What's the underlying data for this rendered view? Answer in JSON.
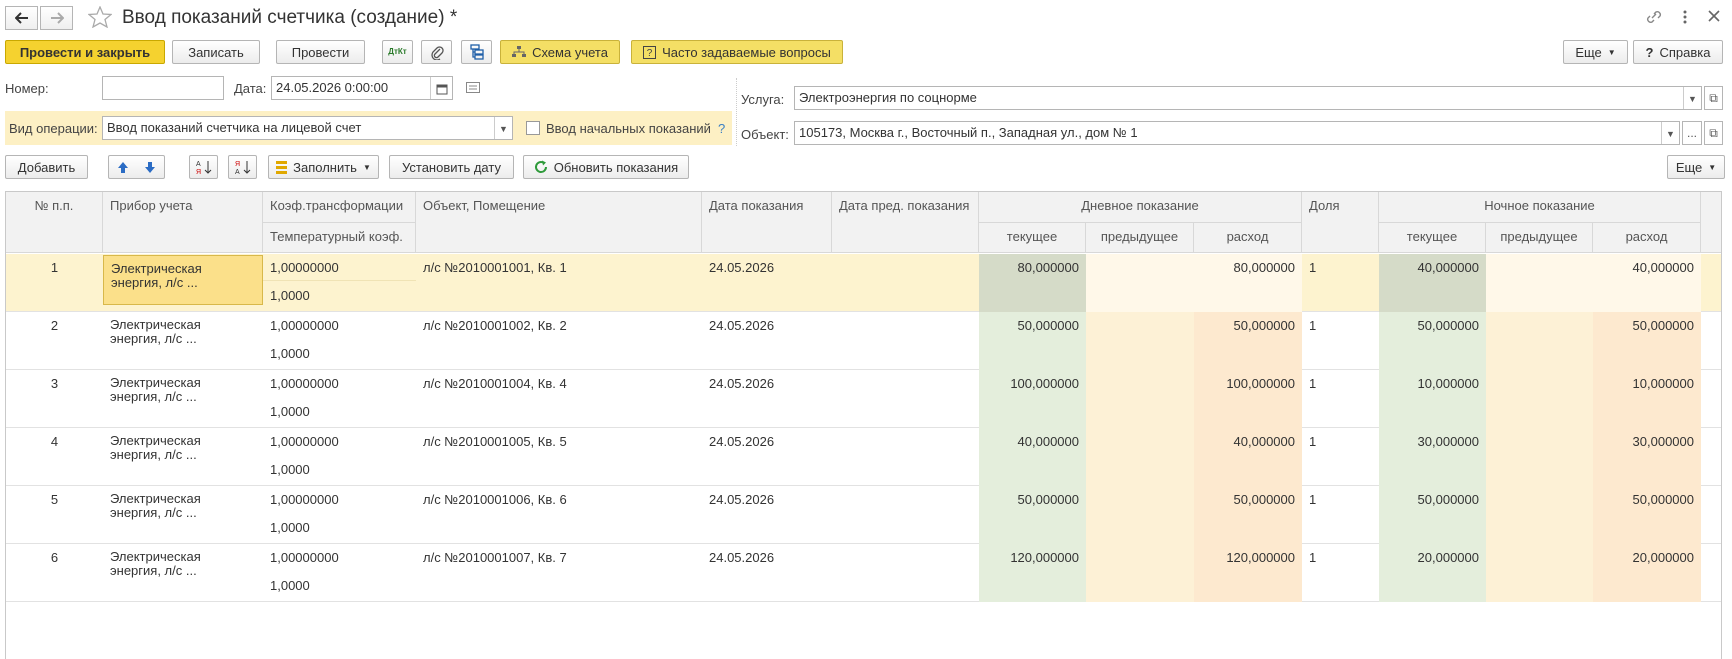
{
  "window": {
    "title": "Ввод показаний счетчика (создание) *"
  },
  "toolbar": {
    "post_and_close": "Провести и закрыть",
    "save": "Записать",
    "post": "Провести",
    "dtkt_label": "ДтКт",
    "scheme": "Схема учета",
    "faq": "Часто задаваемые вопросы",
    "more": "Еще",
    "help": "Справка"
  },
  "header": {
    "number_label": "Номер:",
    "number_value": "",
    "date_label": "Дата:",
    "date_value": "24.05.2026  0:00:00",
    "operation_label": "Вид операции:",
    "operation_value": "Ввод показаний счетчика на лицевой счет",
    "initial_readings_label": "Ввод начальных показаний",
    "initial_readings_help": "?",
    "service_label": "Услуга:",
    "service_value": "Электроэнергия по соцнорме",
    "object_label": "Объект:",
    "object_value": "105173, Москва г., Восточный п., Западная ул., дом № 1"
  },
  "table_toolbar": {
    "add": "Добавить",
    "fill": "Заполнить",
    "set_date": "Установить дату",
    "refresh": "Обновить показания",
    "more": "Еще"
  },
  "table": {
    "headers": {
      "num": "№ п.п.",
      "device": "Прибор учета",
      "koef": "Коэф.трансформации",
      "temp_koef": "Температурный коэф.",
      "object": "Объект, Помещение",
      "date": "Дата показания",
      "prev_date": "Дата пред. показания",
      "day_group": "Дневное показание",
      "day_current": "текущее",
      "day_prev": "предыдущее",
      "day_usage": "расход",
      "share": "Доля",
      "night_group": "Ночное показание",
      "night_current": "текущее",
      "night_prev": "предыдущее",
      "night_usage": "расход"
    },
    "rows": [
      {
        "num": "1",
        "device_l1": "Электрическая",
        "device_l2": "энергия, л/с ...",
        "koef": "1,00000000",
        "temp": "1,0000",
        "object": "л/с №2010001001, Кв. 1",
        "date": "24.05.2026",
        "prev_date": "",
        "day_cur": "80,000000",
        "day_prev": "",
        "day_use": "80,000000",
        "share": "1",
        "night_cur": "40,000000",
        "night_prev": "",
        "night_use": "40,000000"
      },
      {
        "num": "2",
        "device_l1": "Электрическая",
        "device_l2": "энергия, л/с ...",
        "koef": "1,00000000",
        "temp": "1,0000",
        "object": "л/с №2010001002, Кв. 2",
        "date": "24.05.2026",
        "prev_date": "",
        "day_cur": "50,000000",
        "day_prev": "",
        "day_use": "50,000000",
        "share": "1",
        "night_cur": "50,000000",
        "night_prev": "",
        "night_use": "50,000000"
      },
      {
        "num": "3",
        "device_l1": "Электрическая",
        "device_l2": "энергия, л/с ...",
        "koef": "1,00000000",
        "temp": "1,0000",
        "object": "л/с №2010001004, Кв. 4",
        "date": "24.05.2026",
        "prev_date": "",
        "day_cur": "100,000000",
        "day_prev": "",
        "day_use": "100,000000",
        "share": "1",
        "night_cur": "10,000000",
        "night_prev": "",
        "night_use": "10,000000"
      },
      {
        "num": "4",
        "device_l1": "Электрическая",
        "device_l2": "энергия, л/с ...",
        "koef": "1,00000000",
        "temp": "1,0000",
        "object": "л/с №2010001005, Кв. 5",
        "date": "24.05.2026",
        "prev_date": "",
        "day_cur": "40,000000",
        "day_prev": "",
        "day_use": "40,000000",
        "share": "1",
        "night_cur": "30,000000",
        "night_prev": "",
        "night_use": "30,000000"
      },
      {
        "num": "5",
        "device_l1": "Электрическая",
        "device_l2": "энергия, л/с ...",
        "koef": "1,00000000",
        "temp": "1,0000",
        "object": "л/с №2010001006, Кв. 6",
        "date": "24.05.2026",
        "prev_date": "",
        "day_cur": "50,000000",
        "day_prev": "",
        "day_use": "50,000000",
        "share": "1",
        "night_cur": "50,000000",
        "night_prev": "",
        "night_use": "50,000000"
      },
      {
        "num": "6",
        "device_l1": "Электрическая",
        "device_l2": "энергия, л/с ...",
        "koef": "1,00000000",
        "temp": "1,0000",
        "object": "л/с №2010001007, Кв. 7",
        "date": "24.05.2026",
        "prev_date": "",
        "day_cur": "120,000000",
        "day_prev": "",
        "day_use": "120,000000",
        "share": "1",
        "night_cur": "20,000000",
        "night_prev": "",
        "night_use": "20,000000"
      }
    ]
  },
  "colors": {
    "primary_yellow": "#f5d22f",
    "operation_bg": "#fdf0c4",
    "selected_row": "#fdf3cf",
    "day_current_bg": "#e4eedc",
    "day_prev_bg": "#fdf1d6",
    "day_usage_bg": "#fde9cf"
  }
}
